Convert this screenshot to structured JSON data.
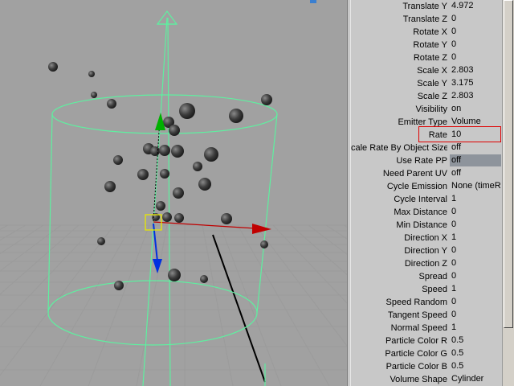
{
  "viewport": {
    "grid_color": "#9b9b9b",
    "emitter_color": "#5ef0a0",
    "particle_color": "#3a3a3a",
    "axis_colors": {
      "x": "#c00000",
      "y": "#00b000",
      "z": "#0030e0"
    },
    "pivot_color": "#e8e800"
  },
  "attributes": [
    {
      "label": "Translate Y",
      "value": "4.972"
    },
    {
      "label": "Translate Z",
      "value": "0"
    },
    {
      "label": "Rotate X",
      "value": "0"
    },
    {
      "label": "Rotate Y",
      "value": "0"
    },
    {
      "label": "Rotate Z",
      "value": "0"
    },
    {
      "label": "Scale X",
      "value": "2.803"
    },
    {
      "label": "Scale Y",
      "value": "3.175"
    },
    {
      "label": "Scale Z",
      "value": "2.803"
    },
    {
      "label": "Visibility",
      "value": "on"
    },
    {
      "label": "Emitter Type",
      "value": "Volume"
    },
    {
      "label": "Rate",
      "value": "10",
      "highlighted": true
    },
    {
      "label": "cale Rate By Object Size",
      "value": "off"
    },
    {
      "label": "Use Rate PP",
      "value": "off",
      "selected": true
    },
    {
      "label": "Need Parent UV",
      "value": "off"
    },
    {
      "label": "Cycle Emission",
      "value": "None (timeR"
    },
    {
      "label": "Cycle Interval",
      "value": "1"
    },
    {
      "label": "Max Distance",
      "value": "0"
    },
    {
      "label": "Min Distance",
      "value": "0"
    },
    {
      "label": "Direction X",
      "value": "1"
    },
    {
      "label": "Direction Y",
      "value": "0"
    },
    {
      "label": "Direction Z",
      "value": "0"
    },
    {
      "label": "Spread",
      "value": "0"
    },
    {
      "label": "Speed",
      "value": "1"
    },
    {
      "label": "Speed Random",
      "value": "0"
    },
    {
      "label": "Tangent Speed",
      "value": "0"
    },
    {
      "label": "Normal Speed",
      "value": "1"
    },
    {
      "label": "Particle Color R",
      "value": "0.5"
    },
    {
      "label": "Particle Color G",
      "value": "0.5"
    },
    {
      "label": "Particle Color B",
      "value": "0.5"
    },
    {
      "label": "Volume Shape",
      "value": "Cylinder"
    }
  ]
}
